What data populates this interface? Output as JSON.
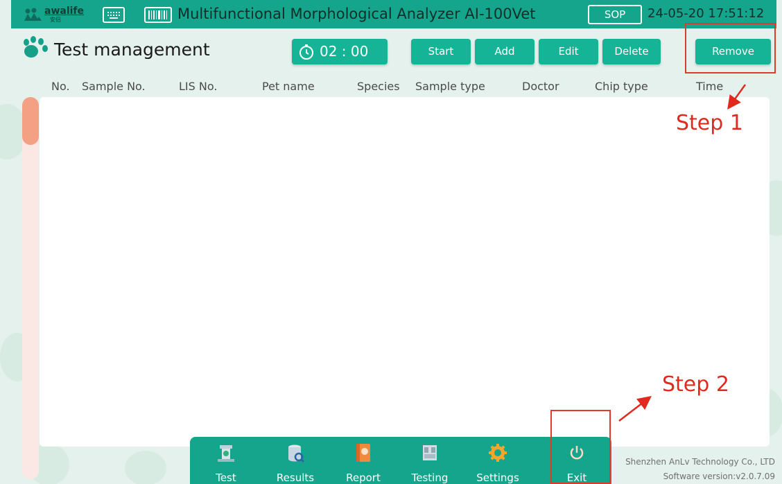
{
  "titlebar": {
    "logo_text": "awalife",
    "logo_sub": "安侣",
    "title": "Multifunctional Morphological Analyzer AI-100Vet",
    "sop_label": "SOP",
    "datetime": "24-05-20 17:51:12"
  },
  "toolbar": {
    "page_title": "Test management",
    "timer": "02 : 00",
    "buttons": {
      "start": "Start",
      "add": "Add",
      "edit": "Edit",
      "delete": "Delete",
      "remove": "Remove"
    }
  },
  "table": {
    "columns": [
      "No.",
      "Sample No.",
      "LIS No.",
      "Pet name",
      "Species",
      "Sample type",
      "Doctor",
      "Chip type",
      "Time"
    ],
    "rows": []
  },
  "bottom_nav": {
    "items": [
      {
        "label": "Test",
        "icon": "test-icon"
      },
      {
        "label": "Results",
        "icon": "results-icon"
      },
      {
        "label": "Report",
        "icon": "report-icon"
      },
      {
        "label": "Testing",
        "icon": "testing-icon"
      },
      {
        "label": "Settings",
        "icon": "settings-icon"
      },
      {
        "label": "Exit",
        "icon": "power-icon"
      }
    ]
  },
  "footer": {
    "company": "Shenzhen AnLv Technology Co., LTD",
    "version": "Software version:v2.0.7.09"
  },
  "annotations": {
    "step1": "Step 1",
    "step2": "Step 2"
  },
  "colors": {
    "accent": "#15a48c",
    "button": "#16b496",
    "background": "#e4f1ec",
    "annotation": "#e03a2a",
    "scrollbar": "#f3a084"
  }
}
